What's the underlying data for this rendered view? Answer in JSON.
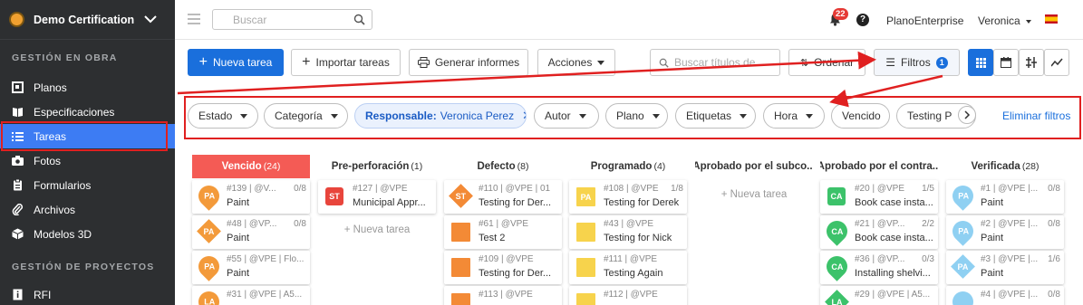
{
  "sidebar": {
    "project": "Demo Certification",
    "sections": [
      {
        "title": "GESTIÓN EN OBRA"
      },
      {
        "title": "GESTIÓN DE PROYECTOS"
      }
    ],
    "items": [
      {
        "label": "Planos",
        "icon": "blueprint-icon"
      },
      {
        "label": "Especificaciones",
        "icon": "book-icon"
      },
      {
        "label": "Tareas",
        "icon": "list-icon",
        "active": true
      },
      {
        "label": "Fotos",
        "icon": "camera-icon"
      },
      {
        "label": "Formularios",
        "icon": "clipboard-icon"
      },
      {
        "label": "Archivos",
        "icon": "paperclip-icon"
      },
      {
        "label": "Modelos 3D",
        "icon": "cube-icon"
      },
      {
        "label": "RFI",
        "icon": "info-doc-icon"
      }
    ]
  },
  "topbar": {
    "search_placeholder": "Buscar",
    "notifications": "22",
    "help": "?",
    "org": "PlanoEnterprise",
    "user": "Veronica"
  },
  "toolbar": {
    "new_task": "Nueva tarea",
    "import": "Importar tareas",
    "reports": "Generar informes",
    "actions": "Acciones",
    "title_search_placeholder": "Buscar títulos de",
    "sort": "Ordenar",
    "filters": "Filtros",
    "filters_count": "1"
  },
  "filters": {
    "chips": [
      {
        "label": "Estado",
        "dropdown": true
      },
      {
        "label": "Categoría",
        "dropdown": true
      },
      {
        "label": "Responsable:",
        "value": "Veronica Perez",
        "active": true
      },
      {
        "label": "Autor",
        "dropdown": true
      },
      {
        "label": "Plano",
        "dropdown": true
      },
      {
        "label": "Etiquetas",
        "dropdown": true
      },
      {
        "label": "Hora",
        "dropdown": true
      },
      {
        "label": "Vencido",
        "dropdown": false
      },
      {
        "label": "Testing P",
        "dropdown": false
      }
    ],
    "clear": "Eliminar filtros"
  },
  "colors": {
    "accent": "#1a6fdc",
    "overdue": "#f45b55",
    "annotation": "#e02020"
  },
  "board": {
    "add_task_label": "+ Nueva tarea",
    "columns": [
      {
        "title": "Vencido",
        "count": "(24)",
        "red": true,
        "cards": [
          {
            "meta": "#139 | @V...",
            "right": "0/8",
            "title": "Paint",
            "av": "PA",
            "shape": "pin",
            "color": "#f39a3a"
          },
          {
            "meta": "#48 | @VP...",
            "right": "0/8",
            "title": "Paint",
            "av": "PA",
            "shape": "dia",
            "color": "#f39a3a"
          },
          {
            "meta": "#55 | @VPE | Flo...",
            "right": "",
            "title": "Paint",
            "av": "PA",
            "shape": "pin",
            "color": "#f39a3a"
          },
          {
            "meta": "#31 | @VPE | A5...",
            "right": "",
            "title": "",
            "av": "LA",
            "shape": "pin",
            "color": "#f39a3a"
          }
        ]
      },
      {
        "title": "Pre-perforación",
        "count": "(1)",
        "cards": [
          {
            "meta": "#127 | @VPE",
            "right": "",
            "title": "Municipal Appr...",
            "av": "ST",
            "shape": "rd",
            "color": "#e8453c"
          }
        ],
        "add": true
      },
      {
        "title": "Defecto",
        "count": "(8)",
        "cards": [
          {
            "meta": "#110 | @VPE | 01",
            "right": "",
            "title": "Testing for Der...",
            "av": "ST",
            "shape": "dia",
            "color": "#f38a36"
          },
          {
            "meta": "#61 | @VPE",
            "right": "",
            "title": "Test 2",
            "av": "",
            "shape": "sq",
            "color": "#f38a36"
          },
          {
            "meta": "#109 | @VPE",
            "right": "",
            "title": "Testing for Der...",
            "av": "",
            "shape": "sq",
            "color": "#f38a36"
          },
          {
            "meta": "#113 | @VPE",
            "right": "",
            "title": "",
            "av": "",
            "shape": "sq",
            "color": "#f38a36"
          }
        ]
      },
      {
        "title": "Programado",
        "count": "(4)",
        "cards": [
          {
            "meta": "#108 | @VPE",
            "right": "1/8",
            "title": "Testing for Derek",
            "av": "PA",
            "shape": "sq",
            "color": "#f7d34c"
          },
          {
            "meta": "#43 | @VPE",
            "right": "",
            "title": "Testing for Nick",
            "av": "",
            "shape": "sq",
            "color": "#f7d34c"
          },
          {
            "meta": "#111 | @VPE",
            "right": "",
            "title": "Testing Again",
            "av": "",
            "shape": "sq",
            "color": "#f7d34c"
          },
          {
            "meta": "#112 | @VPE",
            "right": "",
            "title": "",
            "av": "",
            "shape": "sq",
            "color": "#f7d34c"
          }
        ]
      },
      {
        "title": "Aprobado por el subco...",
        "count": "",
        "cards": [],
        "add": true
      },
      {
        "title": "Aprobado por el contra...",
        "count": "",
        "cards": [
          {
            "meta": "#20 | @VPE",
            "right": "1/5",
            "title": "Book case insta...",
            "av": "CA",
            "shape": "rd",
            "color": "#3cc26a"
          },
          {
            "meta": "#21 | @VP...",
            "right": "2/2",
            "title": "Book case insta...",
            "av": "CA",
            "shape": "pin",
            "color": "#3cc26a"
          },
          {
            "meta": "#36 | @VP...",
            "right": "0/3",
            "title": "Installing shelvi...",
            "av": "CA",
            "shape": "pin",
            "color": "#3cc26a"
          },
          {
            "meta": "#29 | @VPE | A5...",
            "right": "",
            "title": "",
            "av": "LA",
            "shape": "dia",
            "color": "#3cc26a"
          }
        ]
      },
      {
        "title": "Verificada",
        "count": "(28)",
        "cards": [
          {
            "meta": "#1 | @VPE |...",
            "right": "0/8",
            "title": "Paint",
            "av": "PA",
            "shape": "pin",
            "color": "#8fd0f2"
          },
          {
            "meta": "#2 | @VPE |...",
            "right": "0/8",
            "title": "Paint",
            "av": "PA",
            "shape": "pin",
            "color": "#8fd0f2"
          },
          {
            "meta": "#3 | @VPE |...",
            "right": "1/6",
            "title": "Paint",
            "av": "PA",
            "shape": "dia",
            "color": "#8fd0f2"
          },
          {
            "meta": "#4 | @VPE |...",
            "right": "0/8",
            "title": "",
            "av": "",
            "shape": "pin",
            "color": "#8fd0f2"
          }
        ]
      }
    ]
  }
}
